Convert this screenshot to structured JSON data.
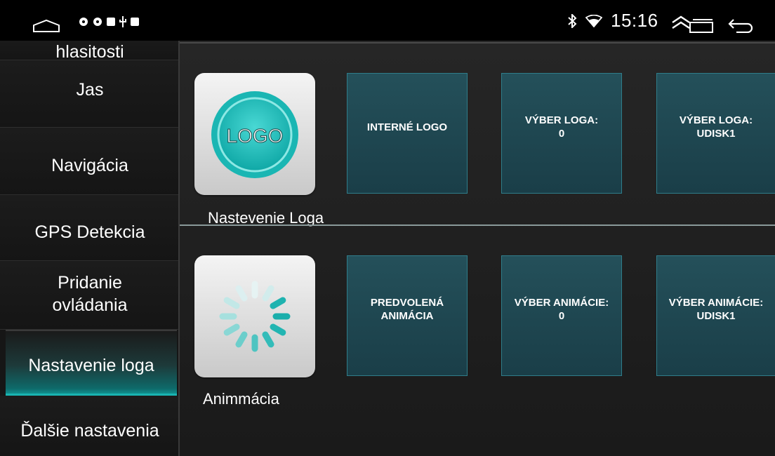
{
  "status_bar": {
    "time": "15:16",
    "icons": [
      "home-icon",
      "notification-icon",
      "notification-icon",
      "stop-icon",
      "usb-icon",
      "stop-icon",
      "bluetooth-icon",
      "wifi-icon",
      "chevron-up-icon",
      "recents-icon",
      "back-icon"
    ]
  },
  "sidebar": {
    "items": [
      {
        "label": "hlasitosti"
      },
      {
        "label": "Jas"
      },
      {
        "label": "Navigácia"
      },
      {
        "label": "GPS Detekcia"
      },
      {
        "label": "Pridanie\novládania"
      },
      {
        "label": "Nastavenie loga",
        "active": true
      },
      {
        "label": "Ďalšie nastavenia"
      }
    ]
  },
  "logo_section": {
    "label": "Nastevenie Loga",
    "icon_text": "LOGO",
    "tiles": [
      {
        "label": "INTERNÉ LOGO"
      },
      {
        "label": "VÝBER LOGA:\n0"
      },
      {
        "label": "VÝBER LOGA:\nUDISK1"
      }
    ]
  },
  "animation_section": {
    "label": "Animmácia",
    "icon": "loading-spinner-icon",
    "tiles": [
      {
        "label": "PREDVOLENÁ\nANIMÁCIA"
      },
      {
        "label": "VÝBER ANIMÁCIE:\n0"
      },
      {
        "label": "VÝBER ANIMÁCIE:\nUDISK1"
      }
    ]
  },
  "colors": {
    "accent": "#19b4b1",
    "tile": "#1f4a55",
    "background": "#1b1b1b"
  }
}
